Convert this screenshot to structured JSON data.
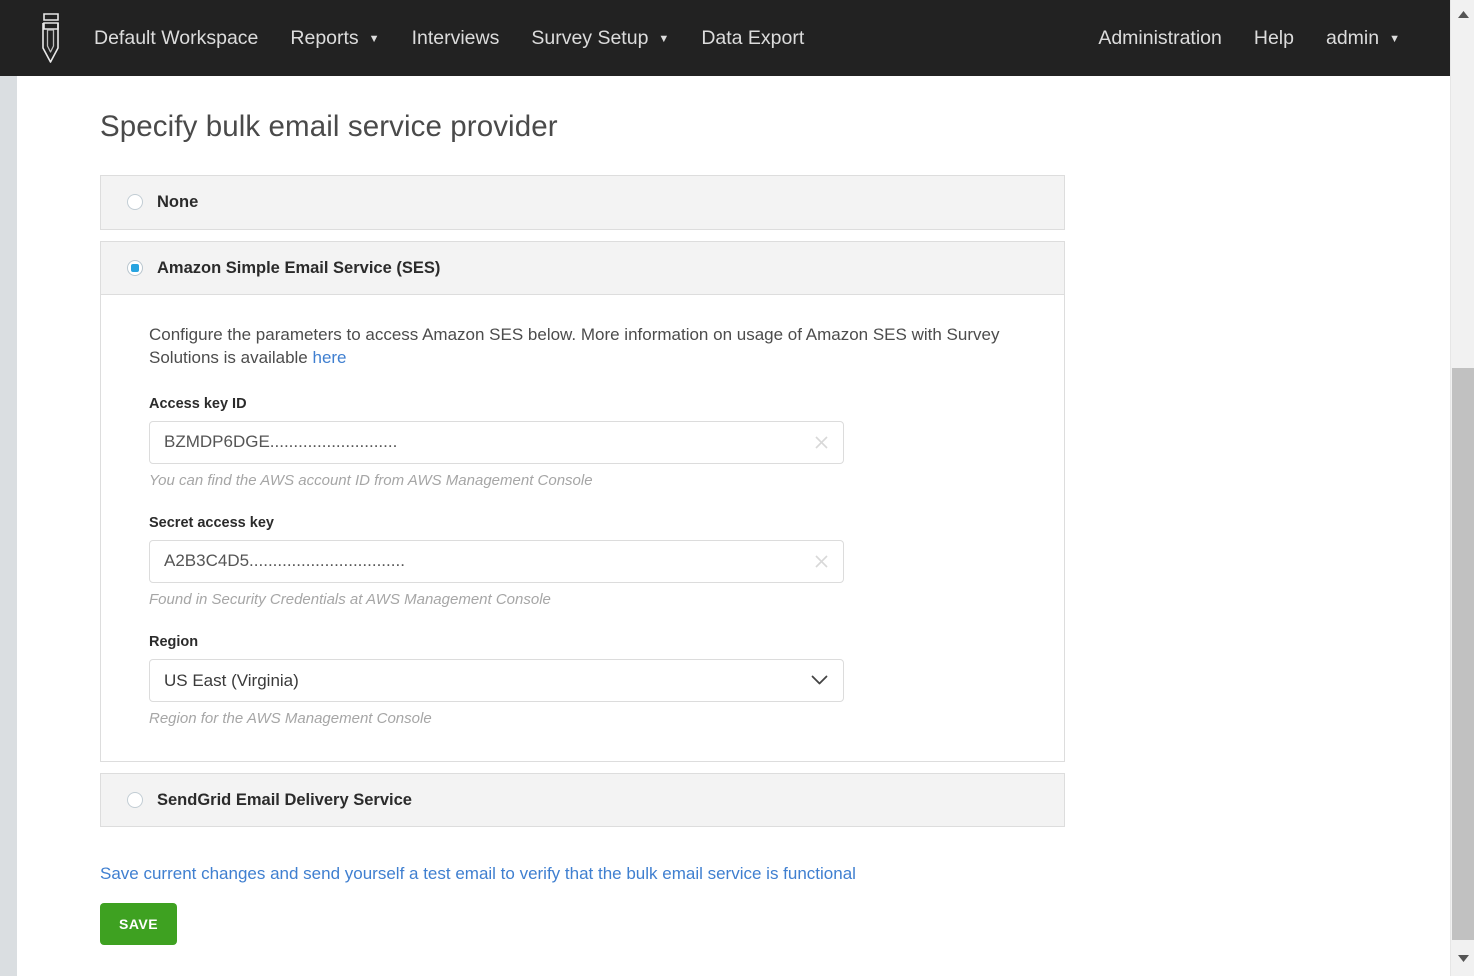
{
  "navbar": {
    "logo_name": "survey-solutions-logo",
    "left_items": [
      {
        "label": "Default Workspace",
        "has_caret": false
      },
      {
        "label": "Reports",
        "has_caret": true
      },
      {
        "label": "Interviews",
        "has_caret": false
      },
      {
        "label": "Survey Setup",
        "has_caret": true
      },
      {
        "label": "Data Export",
        "has_caret": false
      }
    ],
    "right_items": [
      {
        "label": "Administration",
        "has_caret": false
      },
      {
        "label": "Help",
        "has_caret": false
      },
      {
        "label": "admin",
        "has_caret": true
      }
    ],
    "caret_glyph": "▼",
    "background_color": "#222222"
  },
  "page": {
    "title": "Specify bulk email service provider"
  },
  "providers": {
    "none": {
      "label": "None",
      "selected": false
    },
    "ses": {
      "label": "Amazon Simple Email Service (SES)",
      "selected": true,
      "description_before_link": "Configure the parameters to access Amazon SES below. More information on usage of Amazon SES with Survey Solutions is available ",
      "description_link": "here",
      "fields": {
        "access_key_id": {
          "label": "Access key ID",
          "value": "BZMDP6DGE...........................",
          "placeholder": "",
          "hint": "You can find the AWS account ID from AWS Management Console",
          "clear_icon": "close-icon"
        },
        "secret_access_key": {
          "label": "Secret access key",
          "value": "A2B3C4D5.................................",
          "placeholder": "",
          "hint": "Found in Security Credentials at AWS Management Console",
          "clear_icon": "close-icon"
        },
        "region": {
          "label": "Region",
          "value": "US East (Virginia)",
          "hint": "Region for the AWS Management Console",
          "options": [
            "US East (Virginia)"
          ],
          "caret_icon": "chevron-down-icon"
        }
      }
    },
    "sendgrid": {
      "label": "SendGrid Email Delivery Service",
      "selected": false
    }
  },
  "actions": {
    "test_email_link": "Save current changes and send yourself a test email to verify that the bulk email service is functional",
    "save_label": "SAVE",
    "save_color": "#3ea121"
  },
  "scrollbar": {
    "up_arrow_icon": "triangle-up-icon",
    "down_arrow_icon": "triangle-down-icon",
    "thumb_color": "#c1c1c1",
    "track_color": "#f1f1f1"
  }
}
